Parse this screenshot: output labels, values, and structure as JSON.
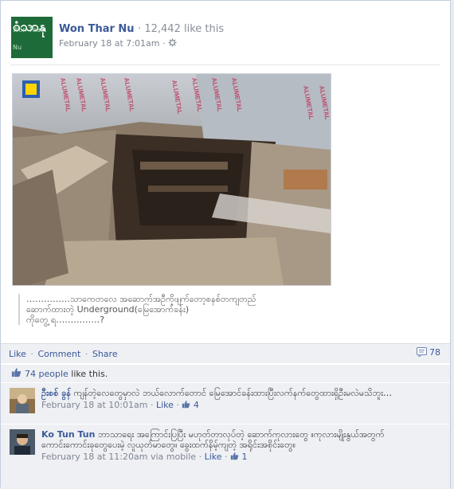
{
  "post": {
    "author_name": "Won Thar Nu",
    "page_likes": "· 12,442 like this",
    "timestamp": "February 18 at 7:01am",
    "meta_sep": "·",
    "avatar_glyph": "ဝံသာနု",
    "avatar_sub": "Won Thar Nu",
    "caption_lines": [
      "……………သာကေတလေ အဆောက်အဦကိုဖျက်တော့စနစ်တကျတည်",
      "ဆောက်ထားတဲ့ Underground(မြေအောက်ခန်း)",
      "ကိုတွေ့ ရ……………?"
    ],
    "photo_labels": [
      "ALUMETAL",
      "ALUMETAL",
      "ALUMETAL",
      "ALUMETAL",
      "ALUMETAL",
      "ALUMETAL",
      "ALUMETAL",
      "ALUMETAL",
      "ALUMETAL",
      "ALUMETAL"
    ]
  },
  "actions": {
    "like": "Like",
    "comment": "Comment",
    "share": "Share",
    "sep": "·",
    "comment_count": "78"
  },
  "likes": {
    "count_link": "74 people",
    "suffix": " like this."
  },
  "comments": [
    {
      "name": "ဦးစစ် ခွန်",
      "text": " ကျန်တဲ့လေတွေမှာလဲ ဘယ်လောက်တောင် မြေအောင်ခန်းထားပြီးလက်နက်တွေထားရှိဦးမလဲမသိဘူး…",
      "timestamp": "February 18 at 10:01am",
      "like": "Like",
      "like_count": "4",
      "sep": "·"
    },
    {
      "name": "Ko Tun Tun",
      "text": " ဘာသာရေး အကြောင်းပြပြီး မဟုတ်တာလုပ်တဲ့ ဆောက်ကုလားတွေ ။ကုလားမျိုးနွယ်အတွက် ကောင်းကောင်းခုတွေပေးမဲ့ လူယုတ်မာတွေ။ ခွေးထက်နိမ့်ကျတဲ့ အရိုင်းအစိုင်းတွေ။",
      "timestamp": "February 18 at 11:20am",
      "via": "via mobile",
      "like": "Like",
      "like_count": "1",
      "sep": "·"
    }
  ],
  "colors": {
    "link": "#3b5998",
    "avatar_bg": "#1e6b3a"
  }
}
